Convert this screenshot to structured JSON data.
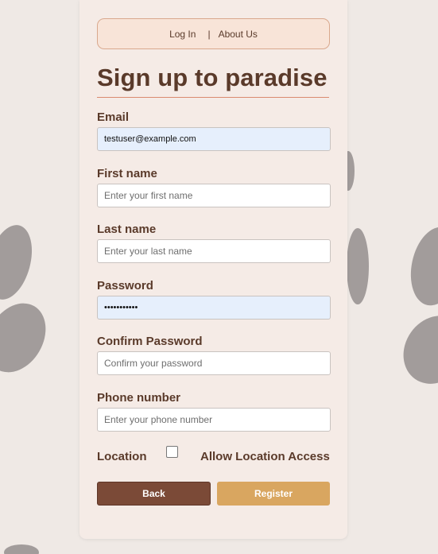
{
  "nav": {
    "login_label": "Log In",
    "separator": "|",
    "about_label": "About Us"
  },
  "page": {
    "title": "Sign up to paradise"
  },
  "form": {
    "email": {
      "label": "Email",
      "value": "testuser@example.com",
      "placeholder": ""
    },
    "first_name": {
      "label": "First name",
      "value": "",
      "placeholder": "Enter your first name"
    },
    "last_name": {
      "label": "Last name",
      "value": "",
      "placeholder": "Enter your last name"
    },
    "password": {
      "label": "Password",
      "value": "•••••••••••",
      "placeholder": ""
    },
    "confirm_password": {
      "label": "Confirm Password",
      "value": "",
      "placeholder": "Confirm your password"
    },
    "phone": {
      "label": "Phone number",
      "value": "",
      "placeholder": "Enter your phone number"
    },
    "location": {
      "label": "Location",
      "checkbox_checked": false,
      "allow_label": "Allow Location Access"
    }
  },
  "buttons": {
    "back_label": "Back",
    "register_label": "Register"
  },
  "colors": {
    "background": "#efe9e5",
    "card": "#f5ebe6",
    "text_brown": "#5a3a2a",
    "back_button": "#7b4a37",
    "register_button": "#d9a660",
    "autofill_blue": "#e6effc",
    "paw_print": "#a29c9b"
  },
  "icons": [
    "paw-print-icon"
  ]
}
